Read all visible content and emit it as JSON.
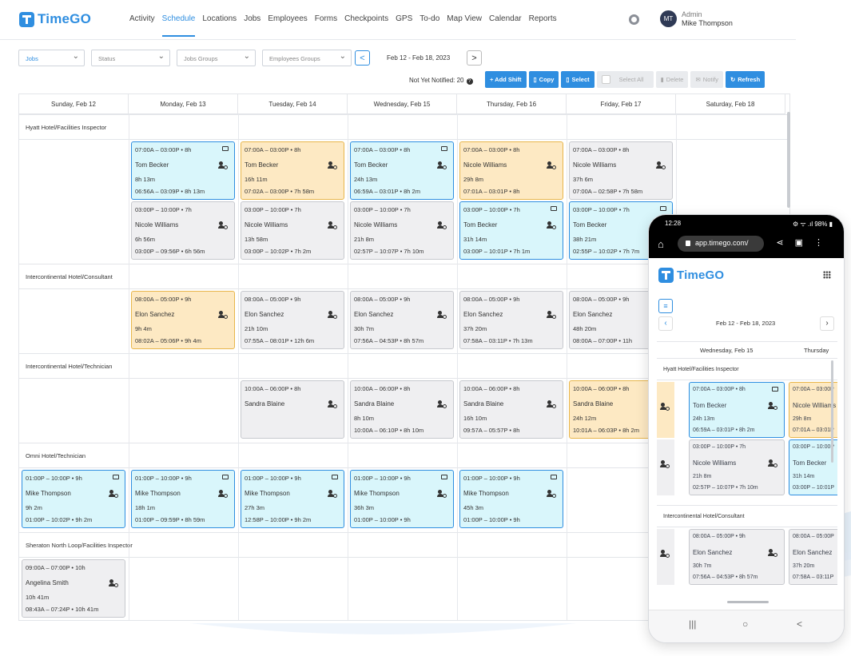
{
  "app": {
    "logo_text": "TimeGO",
    "nav": [
      "Activity",
      "Schedule",
      "Locations",
      "Jobs",
      "Employees",
      "Forms",
      "Checkpoints",
      "GPS",
      "To-do",
      "Map View",
      "Calendar",
      "Reports"
    ],
    "active_nav": "Schedule",
    "avatar_initials": "MT",
    "user_role": "Admin",
    "user_name": "Mike Thompson"
  },
  "filters": {
    "jobs": "Jobs",
    "status": "Status",
    "jobs_groups": "Jobs Groups",
    "employees_groups": "Employees Groups",
    "prev": "<",
    "next": ">",
    "date_range": "Feb 12 - Feb 18, 2023"
  },
  "toolbar": {
    "not_notified": "Not Yet Notified: 20",
    "add_shift": "+ Add Shift",
    "copy": "Copy",
    "select": "Select",
    "select_all": "Select All",
    "delete": "Delete",
    "notify": "Notify",
    "refresh": "Refresh"
  },
  "days": [
    "Sunday, Feb 12",
    "Monday, Feb 13",
    "Tuesday, Feb 14",
    "Wednesday, Feb 15",
    "Thursday, Feb 16",
    "Friday, Feb 17",
    "Saturday, Feb 18"
  ],
  "groups": [
    "Hyatt Hotel/Facilities Inspector",
    "Intercontinental Hotel/Consultant",
    "Intercontinental Hotel/Technician",
    "Omni Hotel/Technician",
    "Sheraton North Loop/Facilities Inspector"
  ],
  "shifts": [
    {
      "time": "07:00A – 03:00P • 8h",
      "name": "Tom Becker",
      "dur": "8h 13m",
      "act": "06:56A – 03:09P • 8h 13m",
      "color": "blue",
      "mail": true
    },
    {
      "time": "07:00A – 03:00P • 8h",
      "name": "Tom Becker",
      "dur": "16h 11m",
      "act": "07:02A – 03:00P • 7h 58m",
      "color": "yellow",
      "mail": false
    },
    {
      "time": "07:00A – 03:00P • 8h",
      "name": "Tom Becker",
      "dur": "24h 13m",
      "act": "06:59A – 03:01P • 8h 2m",
      "color": "blue",
      "mail": true
    },
    {
      "time": "07:00A – 03:00P • 8h",
      "name": "Nicole Williams",
      "dur": "29h 8m",
      "act": "07:01A – 03:01P • 8h",
      "color": "yellow",
      "mail": false
    },
    {
      "time": "07:00A – 03:00P • 8h",
      "name": "Nicole Williams",
      "dur": "37h 6m",
      "act": "07:00A – 02:58P • 7h 58m",
      "color": "gray",
      "mail": false
    },
    {
      "time": "03:00P – 10:00P • 7h",
      "name": "Nicole Williams",
      "dur": "6h 56m",
      "act": "03:00P – 09:56P • 6h 56m",
      "color": "gray",
      "mail": false
    },
    {
      "time": "03:00P – 10:00P • 7h",
      "name": "Nicole Williams",
      "dur": "13h 58m",
      "act": "03:00P – 10:02P • 7h 2m",
      "color": "gray",
      "mail": false
    },
    {
      "time": "03:00P – 10:00P • 7h",
      "name": "Nicole Williams",
      "dur": "21h 8m",
      "act": "02:57P – 10:07P • 7h 10m",
      "color": "gray",
      "mail": false
    },
    {
      "time": "03:00P – 10:00P • 7h",
      "name": "Tom Becker",
      "dur": "31h 14m",
      "act": "03:00P – 10:01P • 7h 1m",
      "color": "blue",
      "mail": true
    },
    {
      "time": "03:00P – 10:00P • 7h",
      "name": "Tom Becker",
      "dur": "38h 21m",
      "act": "02:55P – 10:02P • 7h 7m",
      "color": "blue",
      "mail": true
    },
    {
      "time": "08:00A – 05:00P • 9h",
      "name": "Elon Sanchez",
      "dur": "9h 4m",
      "act": "08:02A – 05:06P • 9h 4m",
      "color": "yellow",
      "mail": false
    },
    {
      "time": "08:00A – 05:00P • 9h",
      "name": "Elon Sanchez",
      "dur": "21h 10m",
      "act": "07:55A – 08:01P • 12h 6m",
      "color": "gray",
      "mail": false
    },
    {
      "time": "08:00A – 05:00P • 9h",
      "name": "Elon Sanchez",
      "dur": "30h 7m",
      "act": "07:56A – 04:53P • 8h 57m",
      "color": "gray",
      "mail": false
    },
    {
      "time": "08:00A – 05:00P • 9h",
      "name": "Elon Sanchez",
      "dur": "37h 20m",
      "act": "07:58A – 03:11P • 7h 13m",
      "color": "gray",
      "mail": false
    },
    {
      "time": "08:00A – 05:00P • 9h",
      "name": "Elon Sanchez",
      "dur": "48h 20m",
      "act": "08:00A – 07:00P • 11h",
      "color": "gray",
      "mail": false
    },
    {
      "time": "10:00A – 06:00P • 8h",
      "name": "Sandra Blaine",
      "dur": "",
      "act": "",
      "color": "gray",
      "mail": false
    },
    {
      "time": "10:00A – 06:00P • 8h",
      "name": "Sandra Blaine",
      "dur": "8h 10m",
      "act": "10:00A – 06:10P • 8h 10m",
      "color": "gray",
      "mail": false
    },
    {
      "time": "10:00A – 06:00P • 8h",
      "name": "Sandra Blaine",
      "dur": "16h 10m",
      "act": "09:57A – 05:57P • 8h",
      "color": "gray",
      "mail": false
    },
    {
      "time": "10:00A – 06:00P • 8h",
      "name": "Sandra Blaine",
      "dur": "24h 12m",
      "act": "10:01A – 06:03P • 8h 2m",
      "color": "yellow",
      "mail": false
    },
    {
      "time": "01:00P – 10:00P • 9h",
      "name": "Mike Thompson",
      "dur": "9h 2m",
      "act": "01:00P – 10:02P • 9h 2m",
      "color": "blue",
      "mail": true
    },
    {
      "time": "01:00P – 10:00P • 9h",
      "name": "Mike Thompson",
      "dur": "18h 1m",
      "act": "01:00P – 09:59P • 8h 59m",
      "color": "blue",
      "mail": true
    },
    {
      "time": "01:00P – 10:00P • 9h",
      "name": "Mike Thompson",
      "dur": "27h 3m",
      "act": "12:58P – 10:00P • 9h 2m",
      "color": "blue",
      "mail": true
    },
    {
      "time": "01:00P – 10:00P • 9h",
      "name": "Mike Thompson",
      "dur": "36h 3m",
      "act": "01:00P – 10:00P • 9h",
      "color": "blue",
      "mail": true
    },
    {
      "time": "01:00P – 10:00P • 9h",
      "name": "Mike Thompson",
      "dur": "45h 3m",
      "act": "01:00P – 10:00P • 9h",
      "color": "blue",
      "mail": true
    },
    {
      "time": "09:00A – 07:00P • 10h",
      "name": "Angelina Smith",
      "dur": "10h 41m",
      "act": "08:43A – 07:24P • 10h 41m",
      "color": "gray",
      "mail": false
    }
  ],
  "phone": {
    "time": "12:28",
    "status_right": "⚙ ᯤ .ıl 98% ▮",
    "url": "app.timego.com/",
    "logo_text": "TimeGO",
    "date_range": "Feb 12 - Feb 18, 2023",
    "day1": "Wednesday, Feb 15",
    "day2": "Thursday",
    "group1": "Hyatt Hotel/Facilities Inspector",
    "group2": "Intercontinental Hotel/Consultant",
    "cards": [
      {
        "time": "07:00A – 03:00P • 8h",
        "name": "Tom Becker",
        "dur": "24h 13m",
        "act": "06:59A – 03:01P • 8h 2m",
        "color": "blue"
      },
      {
        "time": "07:00A – 03:00P",
        "name": "Nicole Williams",
        "dur": "29h 8m",
        "act": "07:01A – 03:01P",
        "color": "yellow"
      },
      {
        "time": "03:00P – 10:00P • 7h",
        "name": "Nicole Williams",
        "dur": "21h 8m",
        "act": "02:57P – 10:07P • 7h 10m",
        "color": "gray"
      },
      {
        "time": "03:00P – 10:00P",
        "name": "Tom Becker",
        "dur": "31h 14m",
        "act": "03:00P – 10:01P",
        "color": "blue"
      },
      {
        "time": "08:00A – 05:00P • 9h",
        "name": "Elon Sanchez",
        "dur": "30h 7m",
        "act": "07:56A – 04:53P • 8h 57m",
        "color": "gray"
      },
      {
        "time": "08:00A – 05:00P",
        "name": "Elon Sanchez",
        "dur": "37h 20m",
        "act": "07:58A – 03:11P",
        "color": "gray"
      }
    ],
    "nav_recent": "|||",
    "nav_home": "○",
    "nav_back": "<"
  }
}
